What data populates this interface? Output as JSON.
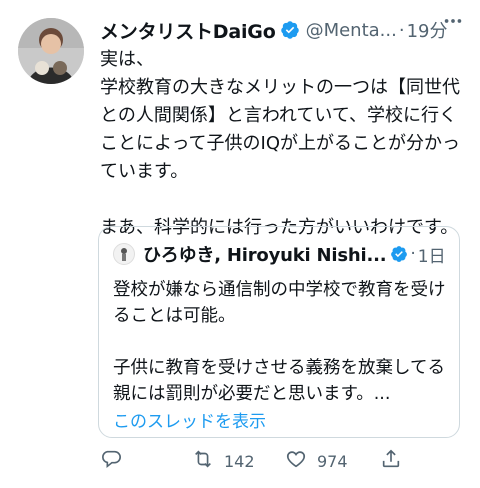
{
  "tweet": {
    "author_name": "メンタリストDaiGo",
    "handle": "@Menta...",
    "separator": "·",
    "time": "19分",
    "text": "実は、\n学校教育の大きなメリットの一つは【同世代との人間関係】と言われていて、学校に行くことによって子供のIQが上がることが分かっています。\n\nまあ、科学的には行った方がいいわけです。",
    "more_icon": "more-icon"
  },
  "quote": {
    "author_name": "ひろゆき, Hiroyuki Nishi...",
    "separator": "·",
    "time": "1日",
    "text": "登校が嫌なら通信制の中学校で教育を受けることは可能。\n\n子供に教育を受けさせる義務を放棄してる親には罰則が必要だと思います。...",
    "show_thread": "このスレッドを表示"
  },
  "actions": {
    "reply_count": "",
    "retweet_count": "142",
    "like_count": "974"
  },
  "colors": {
    "accent": "#1d9bf0",
    "secondary_text": "#536471",
    "border": "#cfd9de"
  }
}
